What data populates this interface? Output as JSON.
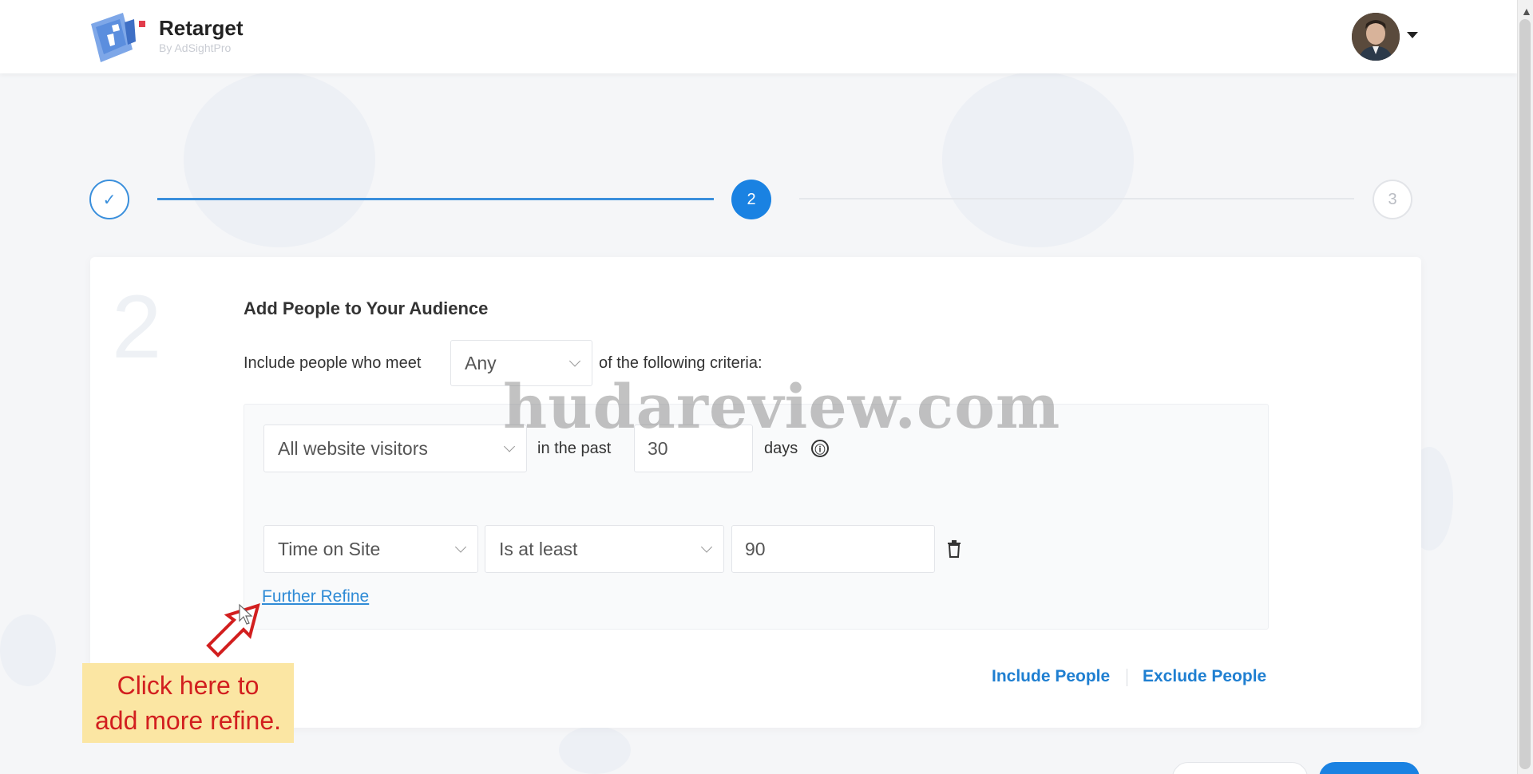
{
  "header": {
    "brand_name": "Retarget",
    "brand_sub": "By AdSightPro"
  },
  "stepper": {
    "steps": [
      {
        "label": "✓",
        "state": "complete"
      },
      {
        "label": "2",
        "state": "active"
      },
      {
        "label": "3",
        "state": "upcoming"
      }
    ],
    "progress_color": "#1a82e2"
  },
  "card": {
    "step_number": "2",
    "title": "Add People to Your Audience",
    "criteria_prefix": "Include people who meet",
    "criteria_match": "Any",
    "criteria_suffix": "of the following criteria:",
    "rule": {
      "visitors_select": "All website visitors",
      "in_the_past": "in the past",
      "days_value": "30",
      "days_label": "days",
      "info_icon": "ⓘ",
      "refine": {
        "metric": "Time on Site",
        "operator": "Is at least",
        "value": "90"
      },
      "further_refine": "Further Refine"
    },
    "include_people": "Include People",
    "exclude_people": "Exclude People"
  },
  "overlay": {
    "watermark": "hudareview.com",
    "callout_line1": "Click here to",
    "callout_line2": "add more refine."
  },
  "colors": {
    "accent": "#1a82e2",
    "link": "#2f8bd6",
    "callout_bg": "#fbe6a3",
    "callout_text": "#d21f1f"
  }
}
